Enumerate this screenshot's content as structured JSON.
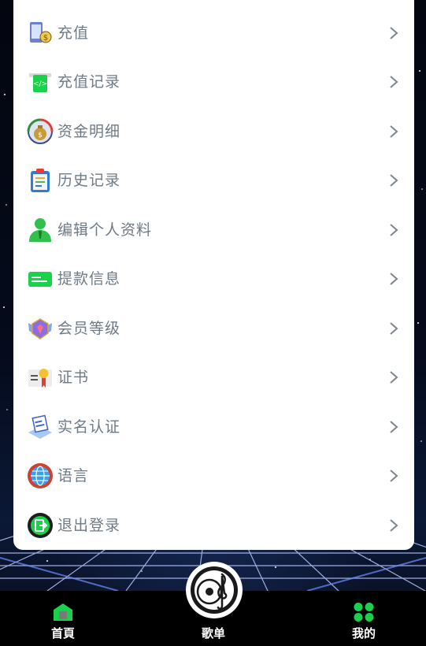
{
  "menu": {
    "items": [
      {
        "label": "充值",
        "icon": "recharge-phone-icon"
      },
      {
        "label": "充值记录",
        "icon": "recharge-record-icon"
      },
      {
        "label": "资金明细",
        "icon": "money-bag-icon"
      },
      {
        "label": "历史记录",
        "icon": "clipboard-icon"
      },
      {
        "label": "编辑个人资料",
        "icon": "user-icon"
      },
      {
        "label": "提款信息",
        "icon": "card-icon"
      },
      {
        "label": "会员等级",
        "icon": "badge-icon"
      },
      {
        "label": "证书",
        "icon": "certificate-icon"
      },
      {
        "label": "实名认证",
        "icon": "verify-icon"
      },
      {
        "label": "语言",
        "icon": "globe-icon"
      },
      {
        "label": "退出登录",
        "icon": "logout-icon"
      }
    ]
  },
  "tabbar": {
    "home_label": "首頁",
    "playlist_label": "歌单",
    "mine_label": "我的"
  },
  "colors": {
    "accent_green": "#19d14b",
    "label_gray": "#6e7a86",
    "card_bg": "#ffffff",
    "tabbar_bg": "#000000"
  }
}
